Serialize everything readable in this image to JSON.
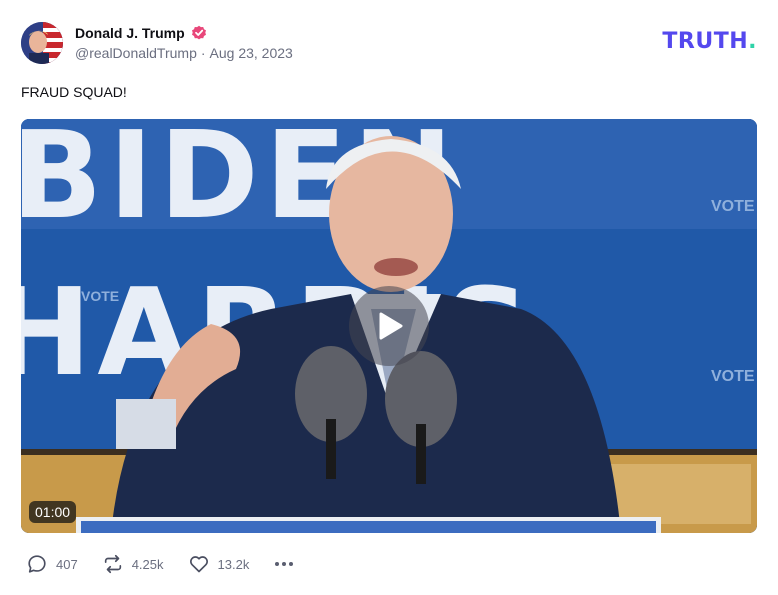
{
  "post": {
    "author_name": "Donald J. Trump",
    "handle": "@realDonaldTrump",
    "separator": "·",
    "date": "Aug 23, 2023",
    "text": "FRAUD SQUAD!"
  },
  "brand": {
    "logo_text": "TRUTH",
    "logo_dot": ".",
    "color": "#5448ee",
    "dot_color": "#2fd3a8"
  },
  "video": {
    "duration": "01:00",
    "sign_line1": "BIDEN",
    "sign_line2": "HARRIS",
    "sign_small": "VOTE"
  },
  "actions": {
    "replies": "407",
    "retruths": "4.25k",
    "likes": "13.2k"
  },
  "icons": {
    "verified": "verified-badge-icon",
    "reply": "reply-bubble-icon",
    "retruth": "retruth-arrows-icon",
    "like": "heart-icon",
    "more": "more-dots-icon",
    "play": "play-icon"
  }
}
